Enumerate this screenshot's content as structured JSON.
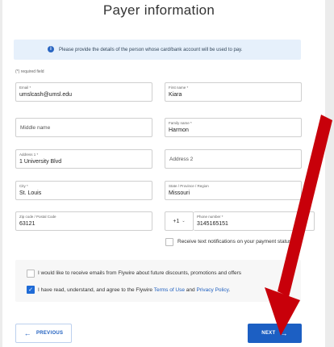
{
  "page": {
    "title": "Payer information",
    "info_banner": "Please provide the details of the person whose card/bank account will be used to pay.",
    "required_note": "(*) required field"
  },
  "form": {
    "email": {
      "label": "Email *",
      "value": "umslcash@umsl.edu"
    },
    "first_name": {
      "label": "First name *",
      "value": "Kiara"
    },
    "middle_name": {
      "placeholder": "Middle name"
    },
    "family_name": {
      "label": "Family name *",
      "value": "Harmon"
    },
    "address1": {
      "label": "Address 1 *",
      "value": "1 University Blvd"
    },
    "address2": {
      "placeholder": "Address 2"
    },
    "city": {
      "label": "City *",
      "value": "St. Louis"
    },
    "state": {
      "label": "State / Province / Region",
      "value": "Missouri"
    },
    "zip": {
      "label": "Zip code / Postal Code",
      "value": "63121"
    },
    "phone_code": "+1",
    "phone": {
      "label": "Phone number *",
      "value": "3145165151"
    },
    "sms_opt_in": "Receive text notifications on your payment status"
  },
  "consent": {
    "emails": "I would like to receive emails from Flywire about future discounts, promotions and offers",
    "terms_prefix": "I have read, understand, and agree to the Flywire ",
    "terms_link": "Terms of Use",
    "terms_and": " and ",
    "privacy_link": "Privacy Policy",
    "terms_suffix": "."
  },
  "buttons": {
    "previous": "PREVIOUS",
    "next": "NEXT"
  },
  "colors": {
    "primary": "#1c5fc3",
    "banner_bg": "#e6f0fb",
    "annotation_arrow": "#c8000a"
  },
  "icons": {
    "info": "info-circle-icon",
    "arrow_left": "arrow-left-icon",
    "arrow_right": "arrow-right-icon",
    "chevron": "chevron-down-icon",
    "check": "check-icon"
  }
}
